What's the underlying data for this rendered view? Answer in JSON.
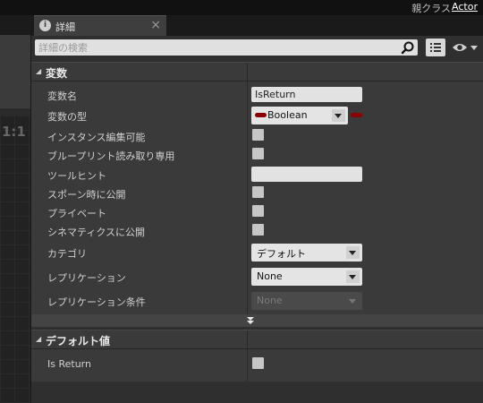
{
  "topbar": {
    "parent_class_label": "親クラス",
    "parent_class_value": "Actor"
  },
  "left_panel": {
    "ratio_text": "1:1"
  },
  "tab": {
    "title": "詳細",
    "icon": "info-icon",
    "close_glyph": "×"
  },
  "search": {
    "placeholder": "詳細の検索",
    "value": ""
  },
  "toolbar": {
    "grid_icon": "list-view-icon",
    "eye_icon": "eye-icon"
  },
  "categories": {
    "variable": {
      "title": "変数"
    },
    "default_value": {
      "title": "デフォルト値"
    }
  },
  "variable_rows": {
    "name": {
      "label": "変数名",
      "value": "IsReturn"
    },
    "type": {
      "label": "変数の型",
      "value": "Boolean",
      "pin_color": "#8a0000"
    },
    "instance_editable": {
      "label": "インスタンス編集可能",
      "checked": false
    },
    "blueprint_readonly": {
      "label": "ブループリント読み取り専用",
      "checked": false
    },
    "tooltip": {
      "label": "ツールヒント",
      "value": ""
    },
    "expose_on_spawn": {
      "label": "スポーン時に公開",
      "checked": false
    },
    "private": {
      "label": "プライベート",
      "checked": false
    },
    "expose_cinematics": {
      "label": "シネマティクスに公開",
      "checked": false
    },
    "category": {
      "label": "カテゴリ",
      "value": "デフォルト"
    },
    "replication": {
      "label": "レプリケーション",
      "value": "None"
    },
    "replication_condition": {
      "label": "レプリケーション条件",
      "value": "None"
    }
  },
  "default_rows": {
    "is_return": {
      "label": "Is Return",
      "checked": false
    }
  },
  "colors": {
    "panel_bg": "#2f2f2f",
    "category_bg": "#3a3a3a",
    "boolean_pin": "#8a0000"
  }
}
